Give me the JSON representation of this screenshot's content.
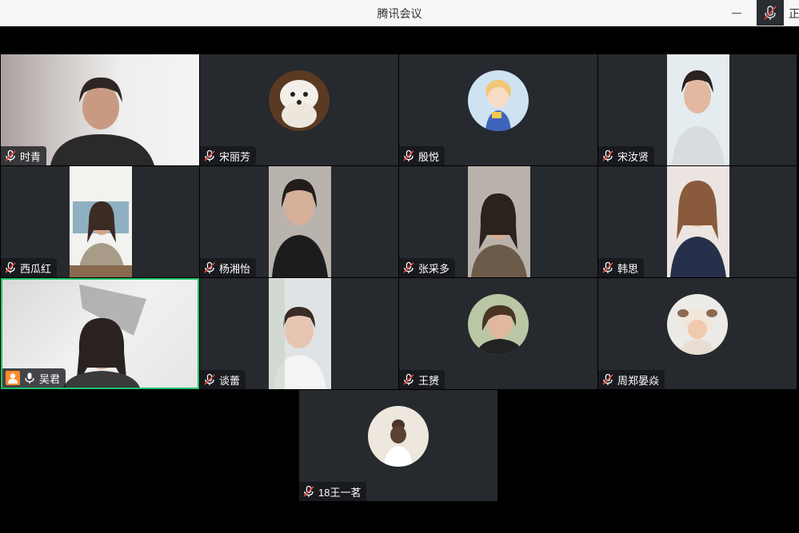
{
  "window": {
    "title": "腾讯会议",
    "corner_text": "正"
  },
  "participants": [
    {
      "name": "时青",
      "type": "video",
      "mic": "muted"
    },
    {
      "name": "宋丽芳",
      "type": "avatar",
      "avatar": "poodle-dog",
      "mic": "muted"
    },
    {
      "name": "殷悦",
      "type": "avatar",
      "avatar": "cartoon-girl",
      "mic": "muted"
    },
    {
      "name": "宋汝贤",
      "type": "video",
      "mic": "muted"
    },
    {
      "name": "西瓜红",
      "type": "video",
      "mic": "muted"
    },
    {
      "name": "杨湘怡",
      "type": "video",
      "mic": "muted"
    },
    {
      "name": "张采多",
      "type": "video",
      "mic": "muted"
    },
    {
      "name": "韩思",
      "type": "video",
      "mic": "muted"
    },
    {
      "name": "吴君",
      "type": "video",
      "mic": "on",
      "active_speaker": true,
      "host": true
    },
    {
      "name": "谈蕾",
      "type": "video",
      "mic": "muted"
    },
    {
      "name": "王赟",
      "type": "avatar",
      "avatar": "woman-photo",
      "mic": "muted"
    },
    {
      "name": "周郑晏焱",
      "type": "avatar",
      "avatar": "baby-photo",
      "mic": "muted"
    },
    {
      "name": "18王一茗",
      "type": "avatar",
      "avatar": "woman-back-photo",
      "mic": "muted"
    }
  ],
  "colors": {
    "active_border": "#22c06a",
    "tile_bg": "#26292e",
    "host_badge": "#ff8b2c"
  }
}
